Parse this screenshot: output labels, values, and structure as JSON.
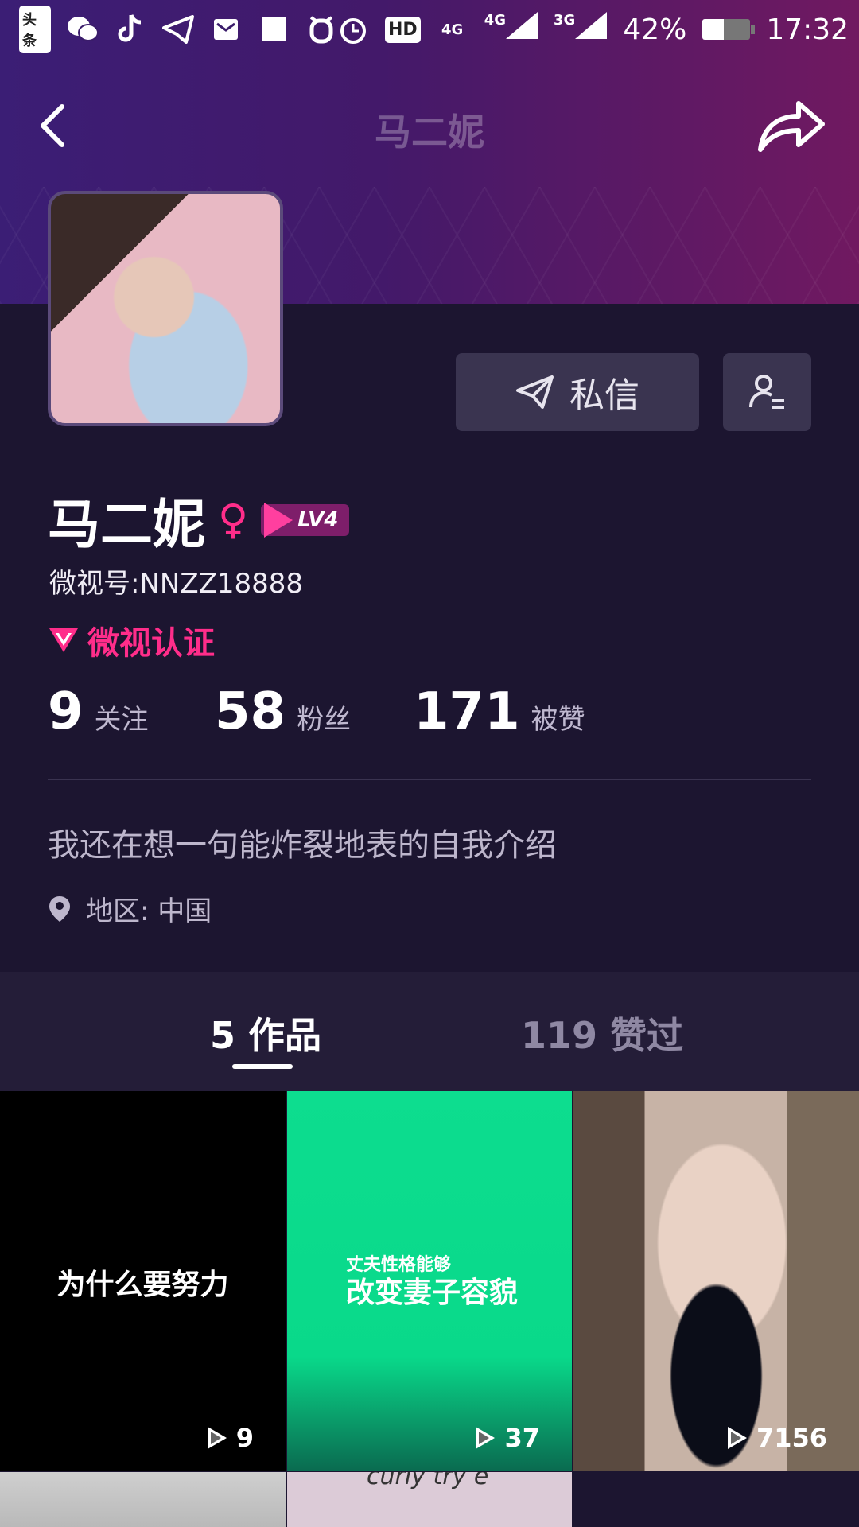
{
  "status_bar": {
    "left_icons": [
      "toutiao-icon",
      "wechat-icon",
      "tiktok-icon",
      "telegram-icon",
      "mail-icon",
      "square-icon",
      "alarm-app-icon"
    ],
    "toutiao_text": "头条",
    "right": {
      "hd": "HD",
      "net1": "4G",
      "net2": "4G",
      "net3": "3G",
      "battery_text": "42%",
      "battery_level": 0.42,
      "time": "17:32"
    }
  },
  "header": {
    "title": "马二妮"
  },
  "profile": {
    "name": "马二妮",
    "gender_symbol": "♀",
    "level": "LV4",
    "weishi_id": "微视号:NNZZ18888",
    "verification": "微视认证",
    "message_button": "私信",
    "stats": [
      {
        "num": "9",
        "label": "关注"
      },
      {
        "num": "58",
        "label": "粉丝"
      },
      {
        "num": "171",
        "label": "被赞"
      }
    ],
    "bio": "我还在想一句能炸裂地表的自我介绍",
    "region": "地区: 中国"
  },
  "tabs": {
    "works": "5 作品",
    "liked": "119 赞过",
    "active": "works"
  },
  "videos": [
    {
      "caption": "为什么要努力",
      "plays": "9",
      "bg": "#000000"
    },
    {
      "caption_small": "丈夫性格能够",
      "caption": "改变妻子容貌",
      "plays": "37",
      "bg": "#0ddd8f"
    },
    {
      "caption": "",
      "plays": "7156"
    }
  ],
  "partial_row": {
    "text": "curly try e"
  },
  "colors": {
    "accent_pink": "#ff2d8a",
    "background": "#1c1530",
    "button_bg": "#3a3450"
  }
}
